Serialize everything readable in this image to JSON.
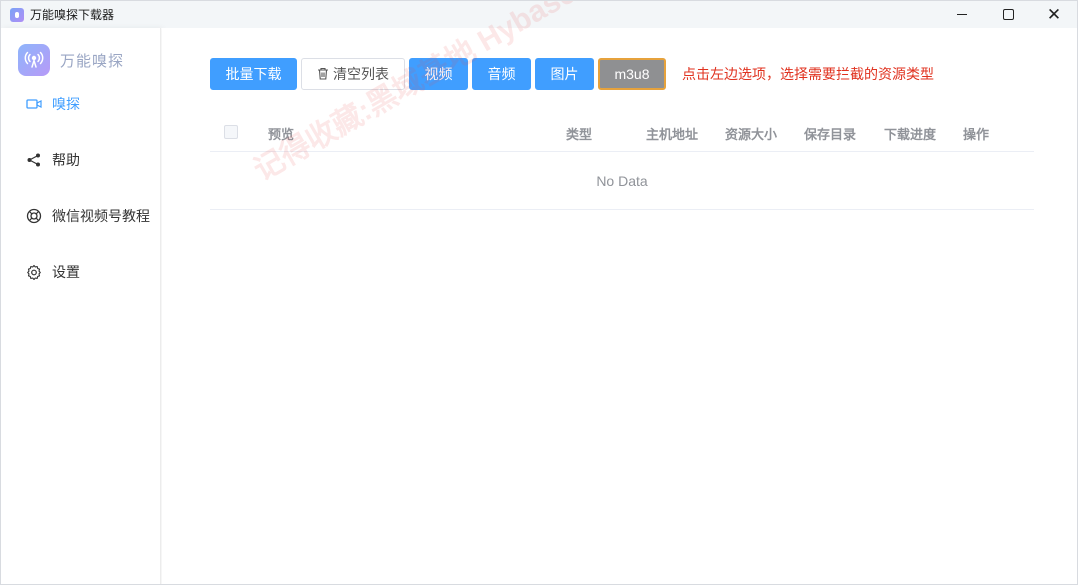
{
  "window": {
    "title": "万能嗅探下载器"
  },
  "sidebar": {
    "brand_name": "万能嗅探",
    "items": [
      {
        "label": "嗅探",
        "icon": "video-camera-icon",
        "active": true
      },
      {
        "label": "帮助",
        "icon": "share-icon",
        "active": false
      },
      {
        "label": "微信视频号教程",
        "icon": "lifebuoy-icon",
        "active": false
      },
      {
        "label": "设置",
        "icon": "gear-icon",
        "active": false
      }
    ]
  },
  "toolbar": {
    "batch_download": "批量下载",
    "clear_list": "清空列表",
    "video": "视频",
    "audio": "音频",
    "image": "图片",
    "m3u8": "m3u8",
    "hint": "点击左边选项，选择需要拦截的资源类型"
  },
  "table": {
    "columns": [
      "预览",
      "类型",
      "主机地址",
      "资源大小",
      "保存目录",
      "下载进度",
      "操作"
    ],
    "empty_text": "No Data"
  },
  "watermark": {
    "text": "记得收藏:黑域基地 Hybase.com"
  },
  "colors": {
    "primary": "#409eff",
    "hint_red": "#e0321f",
    "selected_gray": "#8f9092",
    "selected_border": "#e6a23c"
  }
}
